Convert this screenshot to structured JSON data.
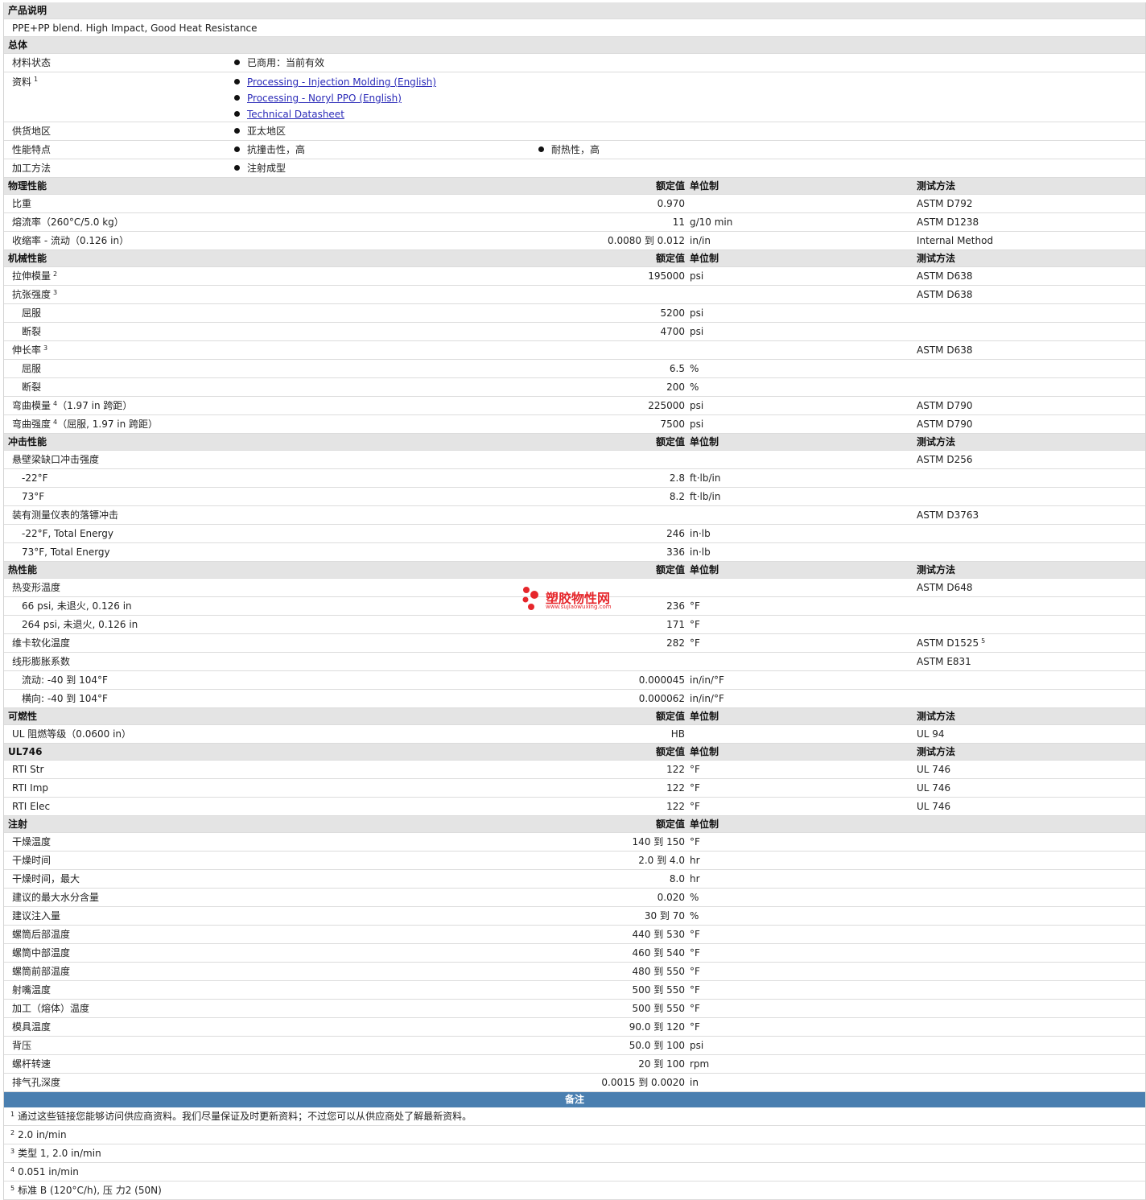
{
  "desc": {
    "header": "产品说明",
    "text": "PPE+PP blend. High Impact, Good Heat Resistance"
  },
  "general": {
    "header": "总体",
    "status": {
      "label": "材料状态",
      "value": "已商用：当前有效"
    },
    "docs": {
      "label": "资料",
      "sup": "1",
      "links": [
        "Processing - Injection Molding (English)",
        "Processing - Noryl PPO (English)",
        "Technical Datasheet"
      ]
    },
    "region": {
      "label": "供货地区",
      "value": "亚太地区"
    },
    "features": {
      "label": "性能特点",
      "values": [
        "抗撞击性，高",
        "耐热性，高"
      ]
    },
    "method": {
      "label": "加工方法",
      "value": "注射成型"
    }
  },
  "cols": {
    "value": "额定值",
    "unit": "单位制",
    "test": "测试方法"
  },
  "sections": [
    {
      "title": "物理性能",
      "show_test": true,
      "rows": [
        {
          "label": "比重",
          "value": "0.970",
          "unit": "",
          "test": "ASTM D792"
        },
        {
          "label": "熔流率（260°C/5.0 kg）",
          "value": "11",
          "unit": "g/10 min",
          "test": "ASTM D1238"
        },
        {
          "label": "收缩率 - 流动（0.126 in）",
          "value": "0.0080 到  0.012",
          "unit": "in/in",
          "test": "Internal Method"
        }
      ]
    },
    {
      "title": "机械性能",
      "show_test": true,
      "rows": [
        {
          "label": "拉伸模量",
          "sup": "2",
          "value": "195000",
          "unit": "psi",
          "test": "ASTM D638"
        },
        {
          "label": "抗张强度",
          "sup": "3",
          "value": "",
          "unit": "",
          "test": "ASTM D638"
        },
        {
          "label": "屈服",
          "sub": true,
          "value": "5200",
          "unit": "psi",
          "test": ""
        },
        {
          "label": "断裂",
          "sub": true,
          "value": "4700",
          "unit": "psi",
          "test": ""
        },
        {
          "label": "伸长率",
          "sup": "3",
          "value": "",
          "unit": "",
          "test": "ASTM D638"
        },
        {
          "label": "屈服",
          "sub": true,
          "value": "6.5",
          "unit": "%",
          "test": ""
        },
        {
          "label": "断裂",
          "sub": true,
          "value": "200",
          "unit": "%",
          "test": ""
        },
        {
          "label": "弯曲模量",
          "sup": "4",
          "suffix": "（1.97 in 跨距）",
          "value": "225000",
          "unit": "psi",
          "test": "ASTM D790"
        },
        {
          "label": "弯曲强度",
          "sup": "4",
          "suffix": "（屈服, 1.97 in 跨距）",
          "value": "7500",
          "unit": "psi",
          "test": "ASTM D790"
        }
      ]
    },
    {
      "title": "冲击性能",
      "show_test": true,
      "rows": [
        {
          "label": "悬壁梁缺口冲击强度",
          "value": "",
          "unit": "",
          "test": "ASTM D256"
        },
        {
          "label": "-22°F",
          "sub": true,
          "value": "2.8",
          "unit": "ft·lb/in",
          "test": ""
        },
        {
          "label": "73°F",
          "sub": true,
          "value": "8.2",
          "unit": "ft·lb/in",
          "test": ""
        },
        {
          "label": "装有测量仪表的落镖冲击",
          "value": "",
          "unit": "",
          "test": "ASTM D3763"
        },
        {
          "label": "-22°F, Total Energy",
          "sub": true,
          "value": "246",
          "unit": "in·lb",
          "test": ""
        },
        {
          "label": "73°F, Total Energy",
          "sub": true,
          "value": "336",
          "unit": "in·lb",
          "test": ""
        }
      ]
    },
    {
      "title": "热性能",
      "show_test": true,
      "rows": [
        {
          "label": "热变形温度",
          "value": "",
          "unit": "",
          "test": "ASTM D648"
        },
        {
          "label": "66 psi, 未退火, 0.126 in",
          "sub": true,
          "value": "236",
          "unit": "°F",
          "test": ""
        },
        {
          "label": "264 psi, 未退火, 0.126 in",
          "sub": true,
          "value": "171",
          "unit": "°F",
          "test": ""
        },
        {
          "label": "维卡软化温度",
          "value": "282",
          "unit": "°F",
          "test": "ASTM D1525",
          "test_sup": "5"
        },
        {
          "label": "线形膨胀系数",
          "value": "",
          "unit": "",
          "test": "ASTM E831"
        },
        {
          "label": "流动: -40 到  104°F",
          "sub": true,
          "value": "0.000045",
          "unit": "in/in/°F",
          "test": ""
        },
        {
          "label": "横向: -40 到  104°F",
          "sub": true,
          "value": "0.000062",
          "unit": "in/in/°F",
          "test": ""
        }
      ]
    },
    {
      "title": "可燃性",
      "show_test": true,
      "rows": [
        {
          "label": "UL 阻燃等级（0.0600 in）",
          "value": "HB",
          "unit": "",
          "test": "UL 94"
        }
      ]
    },
    {
      "title": "UL746",
      "show_test": true,
      "rows": [
        {
          "label": "RTI Str",
          "value": "122",
          "unit": "°F",
          "test": "UL 746"
        },
        {
          "label": "RTI Imp",
          "value": "122",
          "unit": "°F",
          "test": "UL 746"
        },
        {
          "label": "RTI Elec",
          "value": "122",
          "unit": "°F",
          "test": "UL 746"
        }
      ]
    },
    {
      "title": "注射",
      "show_test": false,
      "rows": [
        {
          "label": "干燥温度",
          "value": "140 到  150",
          "unit": "°F",
          "test": ""
        },
        {
          "label": "干燥时间",
          "value": "2.0 到  4.0",
          "unit": "hr",
          "test": ""
        },
        {
          "label": "干燥时间，最大",
          "value": "8.0",
          "unit": "hr",
          "test": ""
        },
        {
          "label": "建议的最大水分含量",
          "value": "0.020",
          "unit": "%",
          "test": ""
        },
        {
          "label": "建议注入量",
          "value": "30 到  70",
          "unit": "%",
          "test": ""
        },
        {
          "label": "螺筒后部温度",
          "value": "440 到  530",
          "unit": "°F",
          "test": ""
        },
        {
          "label": "螺筒中部温度",
          "value": "460 到  540",
          "unit": "°F",
          "test": ""
        },
        {
          "label": "螺筒前部温度",
          "value": "480 到  550",
          "unit": "°F",
          "test": ""
        },
        {
          "label": "射嘴温度",
          "value": "500 到  550",
          "unit": "°F",
          "test": ""
        },
        {
          "label": "加工（熔体）温度",
          "value": "500 到  550",
          "unit": "°F",
          "test": ""
        },
        {
          "label": "模具温度",
          "value": "90.0 到  120",
          "unit": "°F",
          "test": ""
        },
        {
          "label": "背压",
          "value": "50.0 到  100",
          "unit": "psi",
          "test": ""
        },
        {
          "label": "螺杆转速",
          "value": "20 到  100",
          "unit": "rpm",
          "test": ""
        },
        {
          "label": "排气孔深度",
          "value": "0.0015 到  0.0020",
          "unit": "in",
          "test": ""
        }
      ]
    }
  ],
  "notes": {
    "header": "备注",
    "items": [
      {
        "num": "1",
        "text": "通过这些链接您能够访问供应商资料。我们尽量保证及时更新资料；不过您可以从供应商处了解最新资料。"
      },
      {
        "num": "2",
        "text": "2.0 in/min"
      },
      {
        "num": "3",
        "text": "类型  1, 2.0 in/min"
      },
      {
        "num": "4",
        "text": "0.051 in/min"
      },
      {
        "num": "5",
        "text": "标准  B (120°C/h), 压  力2 (50N)"
      }
    ]
  },
  "watermark": {
    "text": "塑胶物性网",
    "url": "www.sujiaowuxing.com",
    "color": "#e6262b"
  }
}
